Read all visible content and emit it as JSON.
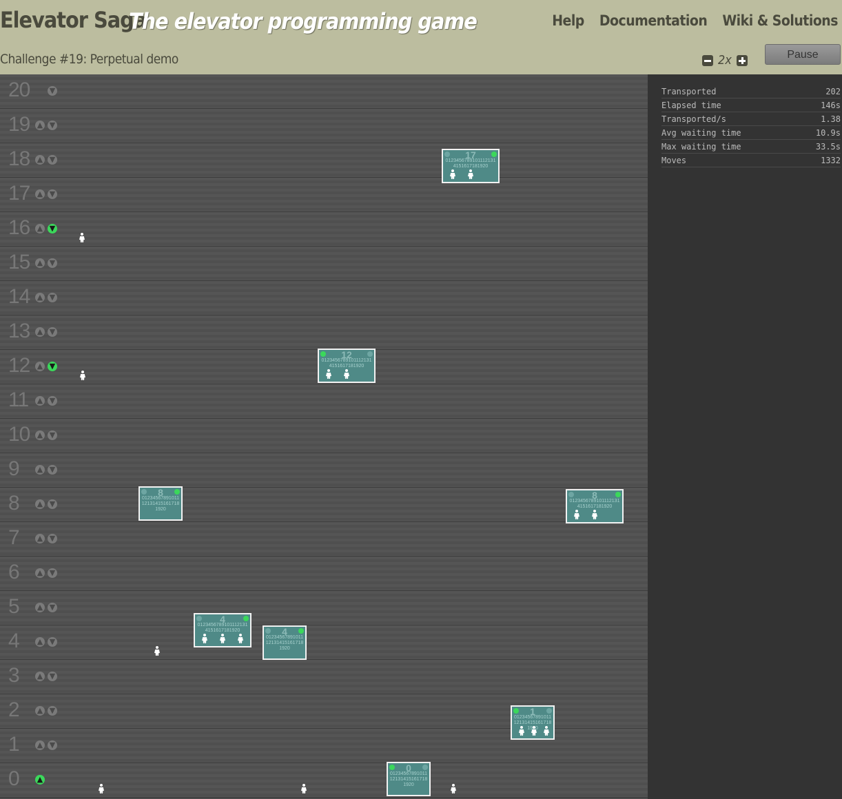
{
  "header": {
    "title": "Elevator Saga",
    "subtitle": "The elevator programming game",
    "nav": [
      "Help",
      "Documentation",
      "Wiki & Solutions"
    ],
    "challenge": "Challenge #19: Perpetual demo",
    "speed": "2x",
    "pause_label": "Pause"
  },
  "stats": [
    {
      "label": "Transported",
      "value": "202"
    },
    {
      "label": "Elapsed time",
      "value": "146s"
    },
    {
      "label": "Transported/s",
      "value": "1.38"
    },
    {
      "label": "Avg waiting time",
      "value": "10.9s"
    },
    {
      "label": "Max waiting time",
      "value": "33.5s"
    },
    {
      "label": "Moves",
      "value": "1332"
    }
  ],
  "floors": [
    {
      "number": "20",
      "up": false,
      "down": false,
      "has_up": false,
      "has_down": true
    },
    {
      "number": "19",
      "up": false,
      "down": false,
      "has_up": true,
      "has_down": true
    },
    {
      "number": "18",
      "up": false,
      "down": false,
      "has_up": true,
      "has_down": true
    },
    {
      "number": "17",
      "up": false,
      "down": false,
      "has_up": true,
      "has_down": true
    },
    {
      "number": "16",
      "up": false,
      "down": true,
      "has_up": true,
      "has_down": true
    },
    {
      "number": "15",
      "up": false,
      "down": false,
      "has_up": true,
      "has_down": true
    },
    {
      "number": "14",
      "up": false,
      "down": false,
      "has_up": true,
      "has_down": true
    },
    {
      "number": "13",
      "up": false,
      "down": false,
      "has_up": true,
      "has_down": true
    },
    {
      "number": "12",
      "up": false,
      "down": true,
      "has_up": true,
      "has_down": true
    },
    {
      "number": "11",
      "up": false,
      "down": false,
      "has_up": true,
      "has_down": true
    },
    {
      "number": "10",
      "up": false,
      "down": false,
      "has_up": true,
      "has_down": true
    },
    {
      "number": "9",
      "up": false,
      "down": false,
      "has_up": true,
      "has_down": true
    },
    {
      "number": "8",
      "up": false,
      "down": false,
      "has_up": true,
      "has_down": true
    },
    {
      "number": "7",
      "up": false,
      "down": false,
      "has_up": true,
      "has_down": true
    },
    {
      "number": "6",
      "up": false,
      "down": false,
      "has_up": true,
      "has_down": true
    },
    {
      "number": "5",
      "up": false,
      "down": false,
      "has_up": true,
      "has_down": true
    },
    {
      "number": "4",
      "up": false,
      "down": false,
      "has_up": true,
      "has_down": true
    },
    {
      "number": "3",
      "up": false,
      "down": false,
      "has_up": true,
      "has_down": true
    },
    {
      "number": "2",
      "up": false,
      "down": false,
      "has_up": true,
      "has_down": true
    },
    {
      "number": "1",
      "up": false,
      "down": false,
      "has_up": true,
      "has_down": true
    },
    {
      "number": "0",
      "up": true,
      "down": false,
      "has_up": true,
      "has_down": false
    }
  ],
  "elevators": [
    {
      "floor": "17",
      "buttons": "01234567891011121314151617181920",
      "up": false,
      "down": true,
      "passengers": 2
    },
    {
      "floor": "12",
      "buttons": "01234567891011121314151617181920",
      "up": true,
      "down": false,
      "passengers": 2
    },
    {
      "floor": "8",
      "buttons": "01234567891011121314151617181920",
      "up": false,
      "down": true,
      "passengers": 0
    },
    {
      "floor": "8",
      "buttons": "01234567891011121314151617181920",
      "up": false,
      "down": true,
      "passengers": 2
    },
    {
      "floor": "4",
      "buttons": "01234567891011121314151617181920",
      "up": false,
      "down": true,
      "passengers": 3
    },
    {
      "floor": "4",
      "buttons": "01234567891011121314151617181920",
      "up": false,
      "down": true,
      "passengers": 0
    },
    {
      "floor": "1",
      "buttons": "01234567891011121314151617181920",
      "up": true,
      "down": false,
      "passengers": 3
    },
    {
      "floor": "0",
      "buttons": "01234567891011121314151617181920",
      "up": true,
      "down": false,
      "passengers": 0
    }
  ],
  "waiting_passengers": [
    {
      "floor": "16",
      "count": 1
    },
    {
      "floor": "12",
      "count": 1
    },
    {
      "floor": "4",
      "count": 1
    },
    {
      "floor": "0",
      "count": 3
    }
  ]
}
